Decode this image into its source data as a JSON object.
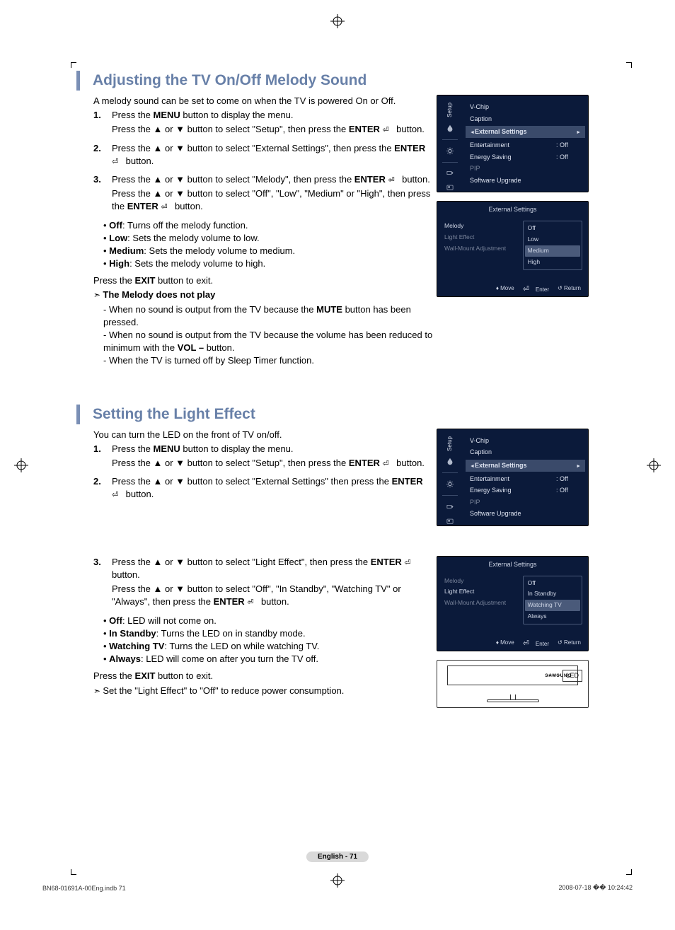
{
  "page": {
    "footer_page": "English - 71",
    "footer_left": "BN68-01691A-00Eng.indb   71",
    "footer_right": "2008-07-18   �� 10:24:42"
  },
  "section1": {
    "title": "Adjusting the TV On/Off Melody Sound",
    "intro": "A melody sound can be set to come on when the TV is powered On or Off.",
    "steps": [
      {
        "n": "1",
        "lines": [
          {
            "pre": "Press the ",
            "b1": "MENU",
            "post": " button to display the menu."
          },
          {
            "pre": "Press the ▲ or ▼ button to select \"Setup\", then press the ",
            "b1": "ENTER",
            "icon": true,
            "post": " button."
          }
        ]
      },
      {
        "n": "2",
        "lines": [
          {
            "pre": "Press the ▲ or ▼ button to select \"External Settings\", then press the ",
            "b1": "ENTER",
            "icon": true,
            "post": " button."
          }
        ]
      },
      {
        "n": "3",
        "lines": [
          {
            "pre": "Press the ▲ or ▼ button to select \"Melody\", then press the ",
            "b1": "ENTER",
            "icon": true,
            "post": " button."
          },
          {
            "pre": "Press the ▲ or ▼ button to select \"Off\", \"Low\", \"Medium\" or \"High\", then press the ",
            "b1": "ENTER",
            "icon": true,
            "post": " button."
          }
        ]
      }
    ],
    "options": [
      {
        "b": "Off",
        "t": ": Turns off the melody function."
      },
      {
        "b": "Low",
        "t": ": Sets the melody volume to low."
      },
      {
        "b": "Medium",
        "t": ": Sets the melody volume to medium."
      },
      {
        "b": "High",
        "t": ": Sets the melody volume to high."
      }
    ],
    "exit_pre": "Press the ",
    "exit_b": "EXIT",
    "exit_post": " button to exit.",
    "note_title": "The Melody does not play",
    "note_items": [
      {
        "pre": "When no sound is output from the TV because the ",
        "b": "MUTE",
        "post": " button has been pressed."
      },
      {
        "pre": "When no sound is output from the TV because the volume has been reduced to minimum with the ",
        "b": "VOL –",
        "post": " button."
      },
      {
        "pre": "When the TV is turned off by Sleep Timer function.",
        "b": "",
        "post": ""
      }
    ]
  },
  "section2": {
    "title": "Setting the Light Effect",
    "intro": "You can turn the LED on the front of TV on/off.",
    "steps": [
      {
        "n": "1",
        "lines": [
          {
            "pre": "Press the ",
            "b1": "MENU",
            "post": " button to display the menu."
          },
          {
            "pre": "Press the ▲ or ▼ button to select \"Setup\", then press the ",
            "b1": "ENTER",
            "icon": true,
            "post": " button."
          }
        ]
      },
      {
        "n": "2",
        "lines": [
          {
            "pre": "Press the ▲ or ▼ button to select \"External Settings\" then press the ",
            "b1": "ENTER",
            "icon": true,
            "post": " button."
          }
        ]
      },
      {
        "n": "3",
        "lines": [
          {
            "pre": "Press the ▲ or ▼ button to select \"Light Effect\", then press the ",
            "b1": "ENTER",
            "icon": true,
            "post": " button."
          },
          {
            "pre": "Press the ▲ or ▼ button to select \"Off\", \"In Standby\", \"Watching TV\" or \"Always\", then press the ",
            "b1": "ENTER",
            "icon": true,
            "post": " button."
          }
        ]
      }
    ],
    "options": [
      {
        "b": "Off",
        "t": ": LED will not come on."
      },
      {
        "b": "In Standby",
        "t": ": Turns the LED on in standby mode."
      },
      {
        "b": "Watching TV",
        "t": ": Turns the LED on while watching TV."
      },
      {
        "b": "Always",
        "t": ": LED will come on after you turn the TV off."
      }
    ],
    "exit_pre": "Press the ",
    "exit_b": "EXIT",
    "exit_post": " button to exit.",
    "note": "Set the \"Light Effect\" to \"Off\" to reduce power consumption."
  },
  "osd_setup": {
    "tab": "Setup",
    "rows": [
      {
        "k": "V-Chip"
      },
      {
        "k": "Caption"
      },
      {
        "k": "External Settings",
        "sel": true
      },
      {
        "k": "Entertainment",
        "v": ": Off"
      },
      {
        "k": "Energy Saving",
        "v": ": Off"
      },
      {
        "k": "PIP",
        "dim": true
      },
      {
        "k": "Software Upgrade"
      }
    ]
  },
  "osd_ext1": {
    "title": "External Settings",
    "left": [
      {
        "t": "Melody",
        "active": true
      },
      {
        "t": "Light Effect"
      },
      {
        "t": "Wall-Mount Adjustment"
      }
    ],
    "right": [
      "Off",
      "Low",
      "Medium",
      "High"
    ],
    "sel": "Medium",
    "footer": {
      "move": "Move",
      "enter": "Enter",
      "ret": "Return"
    }
  },
  "osd_ext2": {
    "title": "External Settings",
    "left": [
      {
        "t": "Melody"
      },
      {
        "t": "Light Effect",
        "active": true
      },
      {
        "t": "Wall-Mount Adjustment"
      }
    ],
    "right": [
      "Off",
      "In Standby",
      "Watching TV",
      "Always"
    ],
    "sel": "Watching TV",
    "footer": {
      "move": "Move",
      "enter": "Enter",
      "ret": "Return"
    }
  },
  "tv_fig": {
    "label": "LED",
    "brand": "SAMSUNG"
  }
}
